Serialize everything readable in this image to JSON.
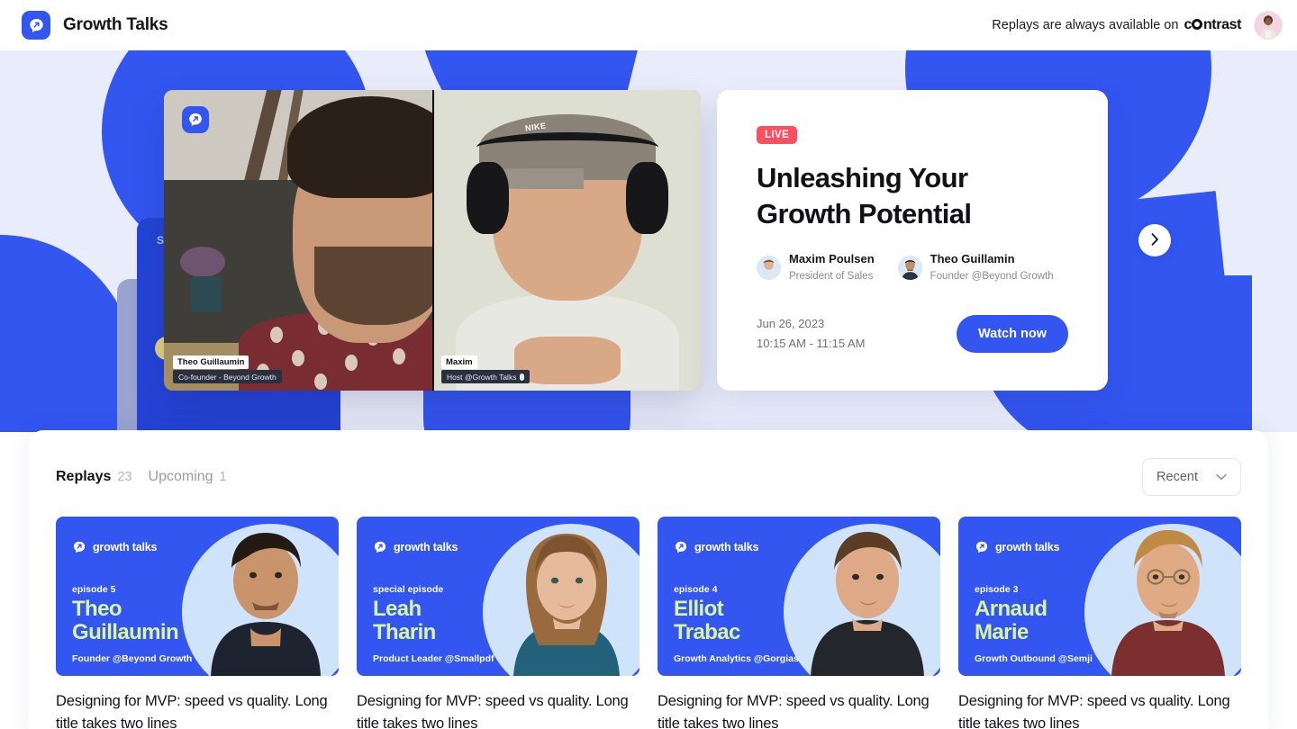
{
  "header": {
    "brand_name": "Growth Talks",
    "logo_icon": "growth-talks-logo-icon",
    "replay_note": "Replays are always available on",
    "contrast_brand_pre": "c",
    "contrast_brand_post": "ntrast",
    "avatar_icon": "user-avatar"
  },
  "hero": {
    "player": {
      "overlay_logo_icon": "growth-talks-logo-icon",
      "tiles": [
        {
          "name": "Theo Guillaumin",
          "role": "Co-founder - Beyond Growth"
        },
        {
          "name": "Maxim",
          "role": "Host @Growth Talks"
        }
      ]
    },
    "stack_label": "Stream",
    "info_card": {
      "badge": "LIVE",
      "title": "Unleashing Your Growth Potential",
      "speakers": [
        {
          "name": "Maxim Poulsen",
          "role": "President of Sales"
        },
        {
          "name": "Theo Guillamin",
          "role": "Founder @Beyond Growth"
        }
      ],
      "date": "Jun 26, 2023",
      "time": "10:15 AM - 11:15 AM",
      "cta_label": "Watch now"
    },
    "next_button_icon": "chevron-right-icon"
  },
  "panel": {
    "tabs": [
      {
        "label": "Replays",
        "count": "23",
        "active": true
      },
      {
        "label": "Upcoming",
        "count": "1",
        "active": false
      }
    ],
    "sort": {
      "selected": "Recent",
      "chevron_icon": "chevron-down-icon",
      "options": [
        "Recent"
      ]
    },
    "cards": [
      {
        "brand": "growth talks",
        "episode": "episode 5",
        "name": "Theo\nGuillaumin",
        "role": "Founder @Beyond Growth",
        "title": "Designing for MVP: speed vs quality. Long title takes two lines"
      },
      {
        "brand": "growth talks",
        "episode": "special episode",
        "name": "Leah\nTharin",
        "role": "Product Leader @Smallpdf",
        "title": "Designing for MVP: speed vs quality. Long title takes two lines"
      },
      {
        "brand": "growth talks",
        "episode": "episode 4",
        "name": "Elliot\nTrabac",
        "role": "Growth Analytics @Gorgias",
        "title": "Designing for MVP: speed vs quality. Long title takes two lines"
      },
      {
        "brand": "growth talks",
        "episode": "episode 3",
        "name": "Arnaud\nMarie",
        "role": "Growth Outbound @Semji",
        "title": "Designing for MVP: speed vs quality. Long title takes two lines"
      }
    ]
  },
  "colors": {
    "brand_blue": "#3355F0",
    "hero_bg": "#E9EDFB",
    "live_red": "#FB5062",
    "card_name_green": "#D9F59B",
    "card_circle_blue": "#CFE4FB"
  }
}
